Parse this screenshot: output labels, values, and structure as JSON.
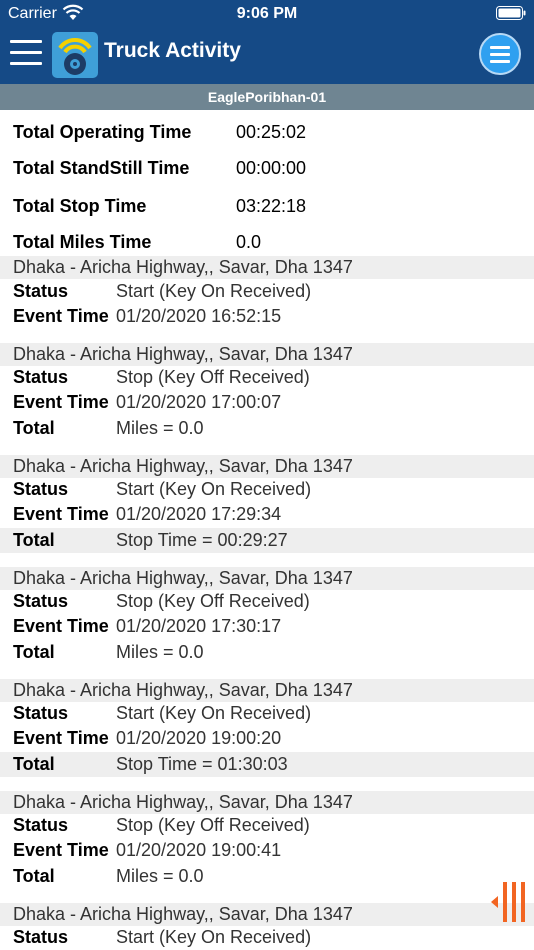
{
  "status_bar": {
    "carrier": "Carrier",
    "time": "9:06 PM"
  },
  "header": {
    "title": "Truck Activity"
  },
  "vehicle_name": "EaglePoribhan-01",
  "summary": [
    {
      "label": "Total Operating Time",
      "value": "00:25:02"
    },
    {
      "label": "Total StandStill Time",
      "value": "00:00:00"
    },
    {
      "label": "Total Stop Time",
      "value": "03:22:18"
    },
    {
      "label": "Total Miles Time",
      "value": "0.0"
    }
  ],
  "field_labels": {
    "status": "Status",
    "event_time": "Event Time",
    "total": "Total"
  },
  "events": [
    {
      "address": "Dhaka - Aricha Highway,, Savar, Dha 1347",
      "status": "Start (Key On Received)",
      "event_time": "01/20/2020 16:52:15",
      "total": ""
    },
    {
      "address": "Dhaka - Aricha Highway,, Savar, Dha 1347",
      "status": "Stop (Key Off Received)",
      "event_time": "01/20/2020 17:00:07",
      "total": "Miles = 0.0"
    },
    {
      "address": "Dhaka - Aricha Highway,, Savar, Dha 1347",
      "status": "Start (Key On Received)",
      "event_time": "01/20/2020 17:29:34",
      "total": "Stop Time = 00:29:27"
    },
    {
      "address": "Dhaka - Aricha Highway,, Savar, Dha 1347",
      "status": "Stop (Key Off Received)",
      "event_time": "01/20/2020 17:30:17",
      "total": "Miles = 0.0"
    },
    {
      "address": "Dhaka - Aricha Highway,, Savar, Dha 1347",
      "status": "Start (Key On Received)",
      "event_time": "01/20/2020 19:00:20",
      "total": "Stop Time = 01:30:03"
    },
    {
      "address": "Dhaka - Aricha Highway,, Savar, Dha 1347",
      "status": "Stop (Key Off Received)",
      "event_time": "01/20/2020 19:00:41",
      "total": "Miles = 0.0"
    },
    {
      "address": "Dhaka - Aricha Highway,, Savar, Dha 1347",
      "status": "Start (Key On Received)",
      "event_time": "",
      "total": ""
    }
  ],
  "colors": {
    "nav": "#154a86",
    "subheader": "#6f8592",
    "row_shade": "#eeeeee",
    "accent": "#2fa0f0",
    "handle": "#f26522"
  },
  "icons": {
    "menu": "hamburger-icon",
    "logo": "app-logo-icon",
    "overflow": "circle-menu-icon",
    "handle": "drawer-handle-icon"
  }
}
